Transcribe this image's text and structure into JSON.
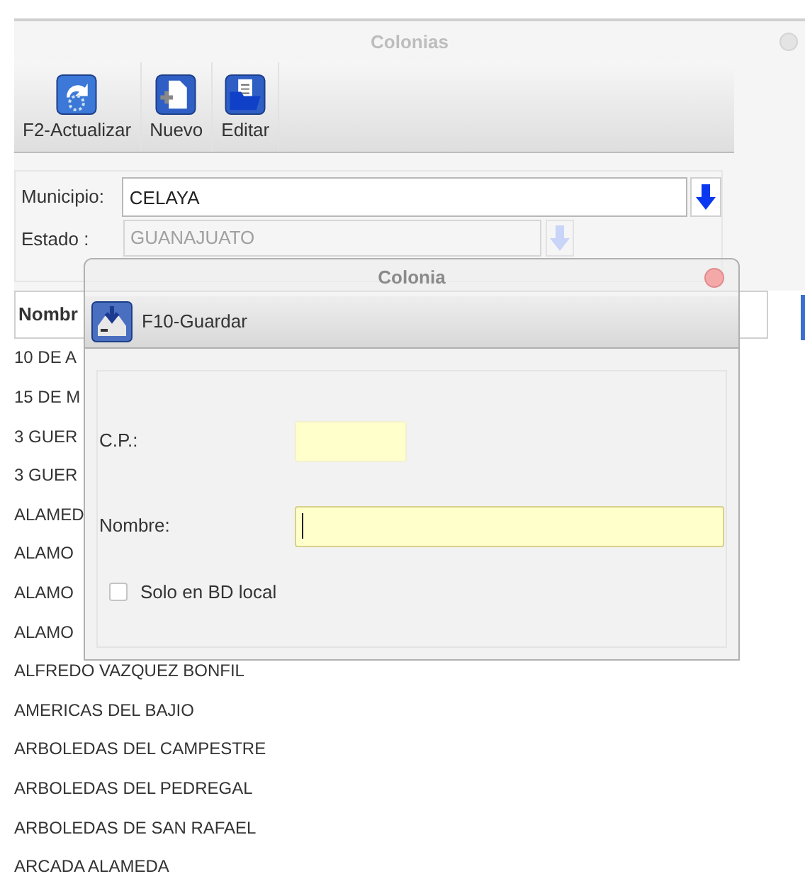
{
  "window": {
    "title": "Colonias"
  },
  "toolbar": [
    {
      "label": "F2-Actualizar"
    },
    {
      "label": "Nuevo"
    },
    {
      "label": "Editar"
    }
  ],
  "filters": [
    {
      "label": "Municipio:",
      "value": "CELAYA",
      "disabled": false
    },
    {
      "label": "Estado :",
      "value": "GUANAJUATO",
      "disabled": true
    }
  ],
  "table": {
    "columns": [
      "Nombr"
    ],
    "rows": [
      "10 DE A",
      "15 DE M",
      "3 GUER",
      "3 GUER",
      "ALAMED",
      "ALAMO",
      "ALAMO",
      "ALAMO",
      "ALFREDO VAZQUEZ BONFIL",
      "AMERICAS DEL BAJIO",
      "ARBOLEDAS DEL CAMPESTRE",
      "ARBOLEDAS DEL PEDREGAL",
      "ARBOLEDAS DE SAN RAFAEL",
      "ARCADA ALAMEDA"
    ]
  },
  "dialog": {
    "title": "Colonia",
    "toolbar": [
      {
        "label": "F10-Guardar"
      }
    ],
    "fields": [
      {
        "label": "C.P.:",
        "kind": "short",
        "focused": false
      },
      {
        "label": "Nombre:",
        "kind": "long",
        "focused": true
      }
    ],
    "checkbox": {
      "label": "Solo en BD local",
      "checked": false
    }
  }
}
